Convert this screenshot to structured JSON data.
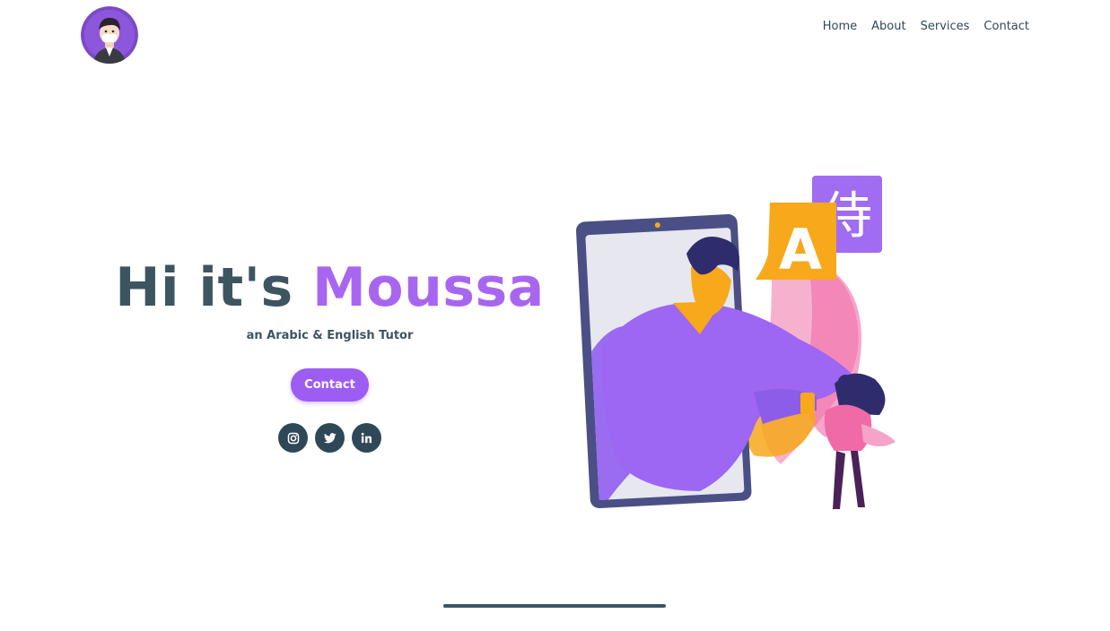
{
  "nav": {
    "items": [
      {
        "label": "Home"
      },
      {
        "label": "About"
      },
      {
        "label": "Services"
      },
      {
        "label": "Contact"
      }
    ]
  },
  "hero": {
    "greeting": "Hi it's ",
    "name": "Moussa",
    "subtitle": "an Arabic & English Tutor",
    "contact_label": "Contact",
    "illustration_glyphs": {
      "letter": "A",
      "character": "侍"
    }
  },
  "socials": [
    {
      "icon": "instagram-icon"
    },
    {
      "icon": "twitter-icon"
    },
    {
      "icon": "linkedin-icon"
    }
  ],
  "colors": {
    "accent": "#9d5cf2",
    "name": "#a866f0",
    "text": "#3d5561",
    "dark": "#2f4858",
    "orange": "#f7a81b",
    "pink": "#f06aa8"
  }
}
